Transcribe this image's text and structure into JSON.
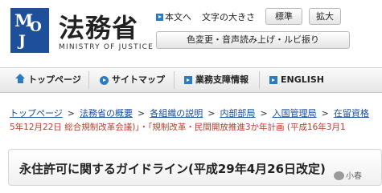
{
  "site": {
    "logo_letters": [
      "M",
      "O",
      "J"
    ],
    "title": "法務省",
    "subtitle": "MINISTRY OF JUSTICE"
  },
  "utility": {
    "english_link": "本文へ",
    "font_size_label": "文字の大きさ",
    "font_standard": "標準",
    "font_large": "拡大",
    "accessibility_button": "色変更・音声読み上げ・ルビ振り"
  },
  "nav": {
    "items": [
      {
        "label": "トップページ",
        "icon": "home-icon"
      },
      {
        "label": "サイトマップ",
        "icon": "arrow-circle-icon"
      },
      {
        "label": "業務支障情報",
        "icon": "arrow-square-icon"
      },
      {
        "label": "ENGLISH",
        "icon": "arrow-square-icon"
      }
    ]
  },
  "breadcrumb": {
    "items": [
      "トップページ",
      "法務省の概要",
      "各組織の説明",
      "内部部局",
      "入国管理局",
      "在留資格"
    ],
    "separator": ">"
  },
  "related_text": "5年12月22日 総合規制改革会議)」・「規制改革・民間開放推進3か年計画 (平成16年3月1",
  "page_title": "永住許可に関するガイドライン(平成29年4月26日改定)",
  "watermark": "小春",
  "colors": {
    "brand_blue": "#1d4f9a",
    "link_blue": "#1a4ea0",
    "icon_blue": "#2a7bbf",
    "related_red": "#c0392b"
  }
}
